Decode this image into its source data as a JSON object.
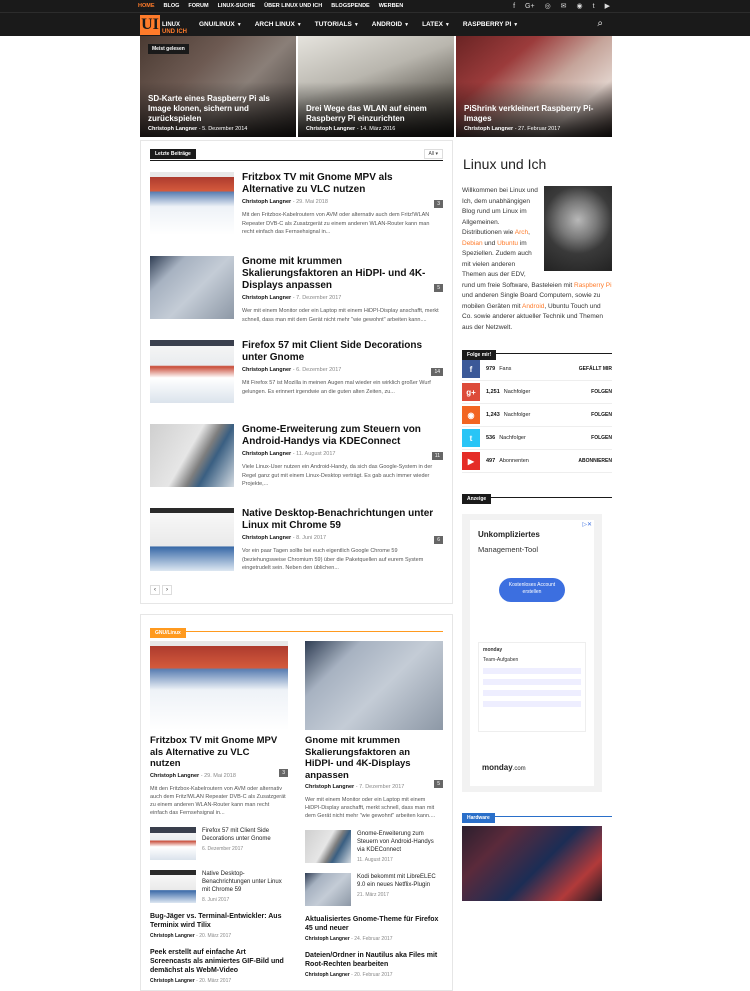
{
  "topbar": {
    "links": [
      "Home",
      "Blog",
      "Forum",
      "Linux-Suche",
      "Über Linux und Ich",
      "Blogspende",
      "Werben"
    ]
  },
  "nav": {
    "logo_letters": "UI",
    "logo_line1": "Linux",
    "logo_line2": "und Ich",
    "items": [
      "GNU/Linux",
      "Arch Linux",
      "Tutorials",
      "Android",
      "LaTeX",
      "Raspberry Pi"
    ]
  },
  "hero": {
    "badge": "Meist gelesen",
    "tiles": [
      {
        "title": "SD-Karte eines Raspberry Pi als Image klonen, sichern und zurückspielen",
        "author": "Christoph Langner",
        "date": "5. Dezember 2014"
      },
      {
        "title": "Drei Wege das WLAN auf einem Raspberry Pi einzurichten",
        "author": "Christoph Langner",
        "date": "14. März 2016"
      },
      {
        "title": "PiShrink verkleinert Raspberry Pi-Images",
        "author": "Christoph Langner",
        "date": "27. Februar 2017"
      }
    ]
  },
  "latest": {
    "label": "Letzte Beiträge",
    "filter": "All",
    "posts": [
      {
        "title": "Fritzbox TV mit Gnome MPV als Alternative zu VLC nutzen",
        "author": "Christoph Langner",
        "date": "29. Mai 2018",
        "count": "3",
        "excerpt": "Mit den Fritzbox-Kabelroutern von AVM oder alternativ auch dem Fritz!WLAN Repeater DVB-C als Zusatzgerät zu einem anderen WLAN-Router kann man recht einfach das Fernsehsignal in..."
      },
      {
        "title": "Gnome mit krummen Skalierungsfaktoren an HiDPI- und 4K-Displays anpassen",
        "author": "Christoph Langner",
        "date": "7. Dezember 2017",
        "count": "5",
        "excerpt": "Wer mit einem Monitor oder ein Laptop mit einem HiDPI-Display anschafft, merkt schnell, dass man mit dem Gerät nicht mehr \"wie gewohnt\" arbeiten kann...."
      },
      {
        "title": "Firefox 57 mit Client Side Decorations unter Gnome",
        "author": "Christoph Langner",
        "date": "6. Dezember 2017",
        "count": "14",
        "excerpt": "Mit Firefox 57 ist Mozilla in meinen Augen mal wieder ein wirklich großer Wurf gelungen. Es erinnert irgendwie an die guten alten Zeiten, zu..."
      },
      {
        "title": "Gnome-Erweiterung zum Steuern von Android-Handys via KDEConnect",
        "author": "Christoph Langner",
        "date": "11. August 2017",
        "count": "11",
        "excerpt": "Viele Linux-User nutzen ein Android-Handy, da sich das Google-System in der Regel ganz gut mit einem Linux-Desktop verträgt. Es gab auch immer wieder Projekte,..."
      },
      {
        "title": "Native Desktop-Benachrichtungen unter Linux mit Chrome 59",
        "author": "Christoph Langner",
        "date": "8. Juni 2017",
        "count": "6",
        "excerpt": "Vor ein paar Tagen sollte bei euch eigentlich Google Chrome 59 (beziehungsweise Chromium 59) über die Paketquellen auf eurem System eingetrudelt sein. Neben den üblichen..."
      }
    ]
  },
  "gnu": {
    "label": "GNU/Linux",
    "left": {
      "title": "Fritzbox TV mit Gnome MPV als Alternative zu VLC nutzen",
      "author": "Christoph Langner",
      "date": "29. Mai 2018",
      "count": "3",
      "excerpt": "Mit den Fritzbox-Kabelroutern von AVM oder alternativ auch dem Fritz!WLAN Repeater DVB-C als Zusatzgerät zu einem anderen WLAN-Router kann man recht einfach das Fernsehsignal in..."
    },
    "right": {
      "title": "Gnome mit krummen Skalierungsfaktoren an HiDPI- und 4K-Displays anpassen",
      "author": "Christoph Langner",
      "date": "7. Dezember 2017",
      "count": "5",
      "excerpt": "Wer mit einem Monitor oder ein Laptop mit einem HiDPI-Display anschafft, merkt schnell, dass man mit dem Gerät nicht mehr \"wie gewohnt\" arbeiten kann...."
    },
    "minis": [
      {
        "title": "Firefox 57 mit Client Side Decorations unter Gnome",
        "date": "6. Dezember 2017"
      },
      {
        "title": "Gnome-Erweiterung zum Steuern von Android-Handys via KDEConnect",
        "date": "11. August 2017"
      },
      {
        "title": "Native Desktop-Benachrichtungen unter Linux mit Chrome 59",
        "date": "8. Juni 2017"
      },
      {
        "title": "Kodi bekommt mit LibreELEC 9.0 ein neues Netflix-Plugin",
        "date": "21. März 2017"
      }
    ],
    "texts": [
      {
        "title": "Bug-Jäger vs. Terminal-Entwickler: Aus Terminix wird Tilix",
        "author": "Christoph Langner",
        "date": "20. März 2017"
      },
      {
        "title": "Aktualisiertes Gnome-Theme für Firefox 45 und neuer",
        "author": "Christoph Langner",
        "date": "24. Februar 2017"
      },
      {
        "title": "Peek erstellt auf einfache Art Screencasts als animiertes GIF-Bild und demächst als WebM-Video",
        "author": "Christoph Langner",
        "date": "20. März 2017"
      },
      {
        "title": "Dateien/Ordner in Nautilus aka Files mit Root-Rechten bearbeiten",
        "author": "Christoph Langner",
        "date": "20. Februar 2017"
      }
    ]
  },
  "side": {
    "heading": "Linux und Ich",
    "about_a": "Willkommen bei Linux und Ich, dem unabhängigen Blog rund um Linux im Allgemeinen. Distributionen wie ",
    "arch": "Arch",
    "comma": ", ",
    "debian": "Debian",
    "und": " und ",
    "ubuntu": "Ubuntu",
    "about_b": " im Speziellen. Zudem auch mit vielen anderen Themen aus der EDV, rund um freie Software, Basteleien mit ",
    "raspi": "Raspberry Pi",
    "about_c": " und anderen Single Board Computern, sowie zu mobilen Geräten mit ",
    "android": "Android",
    "about_d": ", Ubuntu Touch und Co. sowie anderer aktueller Technik und Themen aus der Netzwelt.",
    "follow_label": "Folge mir!",
    "social": [
      {
        "icon": "f",
        "count": "979",
        "label": "Fans",
        "action": "GEFÄLLT MIR",
        "color": "#3b5998"
      },
      {
        "icon": "g+",
        "count": "1,251",
        "label": "Nachfolger",
        "action": "FOLGEN",
        "color": "#dd4b39"
      },
      {
        "icon": "◉",
        "count": "1,243",
        "label": "Nachfolger",
        "action": "FOLGEN",
        "color": "#f26522"
      },
      {
        "icon": "t",
        "count": "536",
        "label": "Nachfolger",
        "action": "FOLGEN",
        "color": "#29c5f6"
      },
      {
        "icon": "▶",
        "count": "497",
        "label": "Abonnenten",
        "action": "ABONNIEREN",
        "color": "#e52d27"
      }
    ],
    "ad_label": "Anzeige",
    "ad": {
      "headline": "Unkompliziertes",
      "sub": "Management-Tool",
      "cta": "Kostenloses Account erstellen",
      "card_brand": "monday",
      "card_title": "Team-Aufgaben",
      "brand": "monday",
      "brand_suffix": ".com"
    },
    "hw_label": "Hardware"
  }
}
